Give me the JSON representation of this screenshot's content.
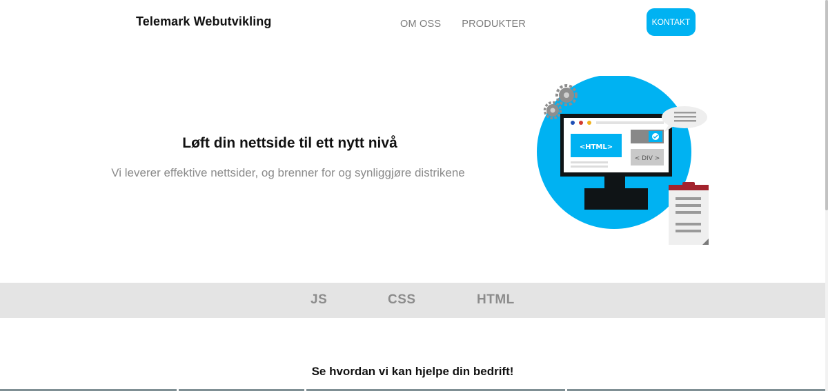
{
  "header": {
    "brand": "Telemark Webutvikling",
    "nav": [
      "OM OSS",
      "PRODUKTER"
    ],
    "cta": "KONTAKT"
  },
  "hero": {
    "title": "Løft din nettside til ett nytt nivå",
    "subtitle": "Vi leverer effektive nettsider, og brenner for og synliggjøre distrikene",
    "illustration": {
      "html_tag": "<HTML>",
      "div_tag": "< DIV >"
    }
  },
  "tech_band": {
    "items": [
      "JS",
      "CSS",
      "HTML"
    ]
  },
  "section": {
    "title": "Se hvordan vi kan hjelpe din bedrift!"
  },
  "colors": {
    "accent": "#00b2f2",
    "band": "#e4e4e4",
    "muted_text": "#8a8a8a",
    "dark": "#111111",
    "clipboard_red": "#a3232d"
  }
}
